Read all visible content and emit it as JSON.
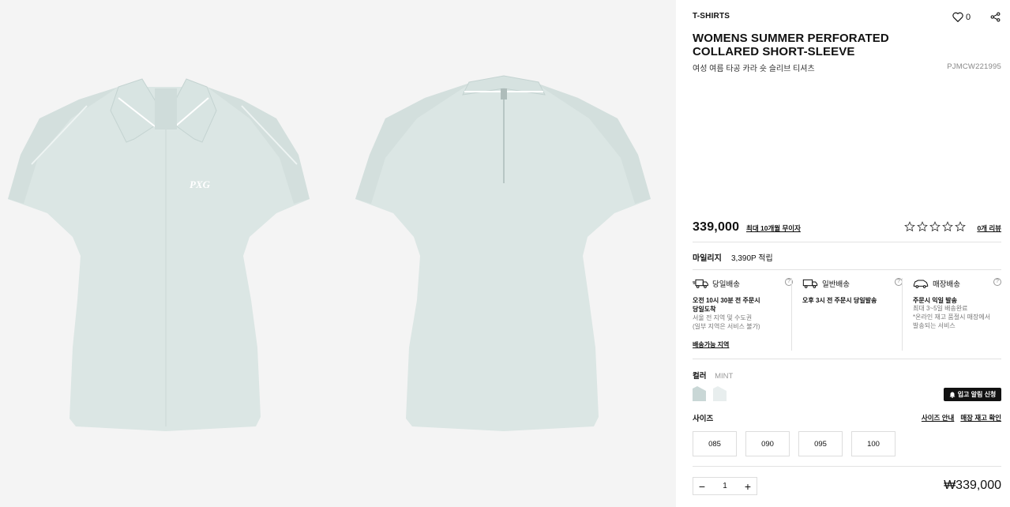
{
  "product": {
    "category": "T-SHIRTS",
    "like_count": "0",
    "title": "WOMENS SUMMER PERFORATED COLLARED SHORT-SLEEVE",
    "subtitle_ko": "여성 여름 타공 카라 숏 슬리브 티셔츠",
    "code": "PJMCW221995"
  },
  "gallery": {
    "images": [
      {
        "icon": "front-shirt-image",
        "logo_text": "PXG"
      },
      {
        "icon": "back-shirt-image"
      }
    ]
  },
  "pricing": {
    "price": "339,000",
    "installment_link": "최대 10개월 무이자",
    "rating_stars": 0,
    "reviews_link": "0개 리뷰"
  },
  "mileage": {
    "label": "마일리지",
    "value": "3,390P 적립"
  },
  "shipping": [
    {
      "icon": "truck-fast-icon",
      "title": "당일배송",
      "line1": "오전 10시 30분 전 주문시\n당일도착",
      "line2": "서울 전 지역 및 수도권\n(일부 지역은 서비스 불가)",
      "link": "배송가능 지역"
    },
    {
      "icon": "truck-icon",
      "title": "일반배송",
      "line1": "오후 3시 전 주문시 당일발송",
      "line2": "",
      "link": ""
    },
    {
      "icon": "car-store-icon",
      "title": "매장배송",
      "line1": "주문시 익일 발송",
      "line2": "최대 3~5일 배송완료\n*온라인 재고 품절시 매장에서\n발송되는 서비스",
      "link": ""
    }
  ],
  "color": {
    "label": "컬러",
    "selected": "MINT",
    "swatches": [
      "#c9d7d6",
      "#e8eeee"
    ]
  },
  "restock_button": "입고 알림 신청",
  "size": {
    "label": "사이즈",
    "guide_link": "사이즈 안내",
    "stock_link": "매장 재고 확인",
    "options": [
      "085",
      "090",
      "095",
      "100"
    ]
  },
  "quantity": {
    "minus": "−",
    "value": "1",
    "plus": "+"
  },
  "total": "₩339,000",
  "colors": {
    "shirt": "#dbe6e4",
    "shirt_shade": "#c9d7d5",
    "gallery_bg": "#f4f4f4"
  }
}
